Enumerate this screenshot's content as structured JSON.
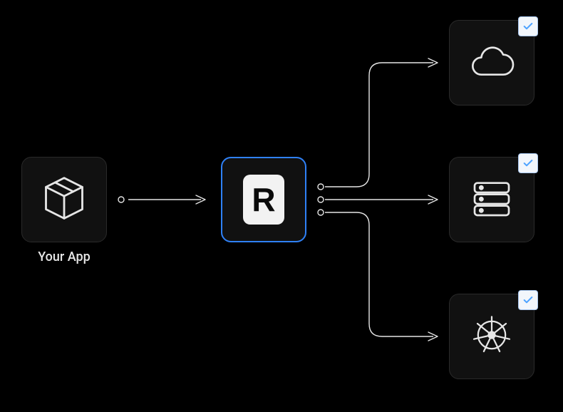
{
  "diagram": {
    "source": {
      "label": "Your App",
      "icon": "box-icon"
    },
    "hub": {
      "label": "R",
      "icon": "r-badge-icon"
    },
    "targets": [
      {
        "icon": "cloud-icon",
        "checked": true
      },
      {
        "icon": "server-icon",
        "checked": true
      },
      {
        "icon": "kubernetes-icon",
        "checked": true
      }
    ],
    "colors": {
      "accent": "#2f81f7",
      "check_bg": "#f2f6fb",
      "check_stroke": "#4ea3ff"
    }
  }
}
